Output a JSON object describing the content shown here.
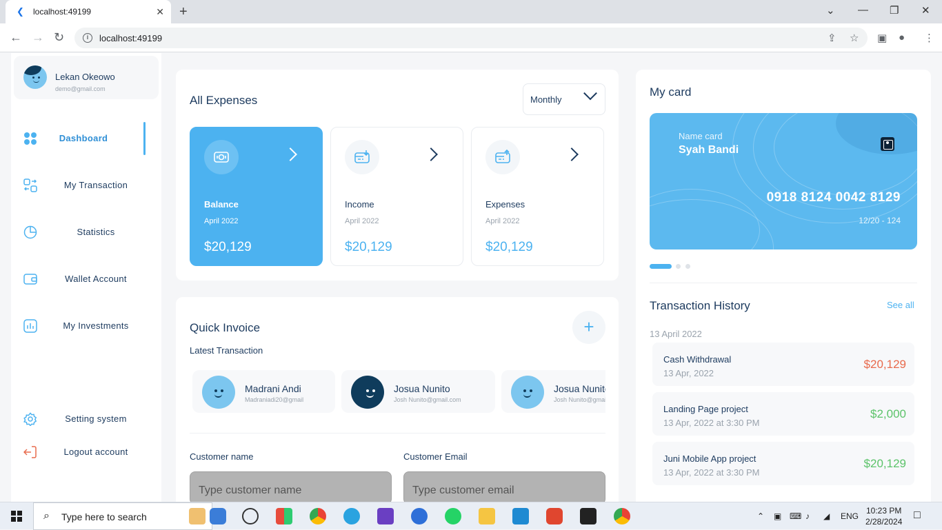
{
  "browser": {
    "tab_title": "localhost:49199",
    "url": "localhost:49199"
  },
  "profile": {
    "name": "Lekan Okeowo",
    "email": "demo@gmail.com"
  },
  "nav": {
    "dashboard": "Dashboard",
    "transaction": "My Transaction",
    "statistics": "Statistics",
    "wallet": "Wallet Account",
    "investments": "My Investments",
    "settings": "Setting system",
    "logout": "Logout account"
  },
  "expenses": {
    "title": "All Expenses",
    "period": "Monthly",
    "cards": [
      {
        "title": "Balance",
        "date": "April 2022",
        "value": "$20,129"
      },
      {
        "title": "Income",
        "date": "April 2022",
        "value": "$20,129"
      },
      {
        "title": "Expenses",
        "date": "April 2022",
        "value": "$20,129"
      }
    ]
  },
  "invoice": {
    "title": "Quick Invoice",
    "subtitle": "Latest Transaction",
    "contacts": [
      {
        "name": "Madrani Andi",
        "email": "Madraniadi20@gmail"
      },
      {
        "name": "Josua Nunito",
        "email": "Josh Nunito@gmail.com"
      },
      {
        "name": "Josua Nunito",
        "email": "Josh Nunito@gmail.com"
      }
    ],
    "customer_name_label": "Customer name",
    "customer_email_label": "Customer Email",
    "customer_name_placeholder": "Type customer name",
    "customer_email_placeholder": "Type customer email"
  },
  "mycard": {
    "title": "My card",
    "name_label": "Name card",
    "name": "Syah Bandi",
    "number": "0918 8124 0042 8129",
    "expiry": "12/20 - 124"
  },
  "history": {
    "title": "Transaction History",
    "see_all": "See all",
    "date": "13 April 2022",
    "items": [
      {
        "title": "Cash Withdrawal",
        "date": "13 Apr, 2022",
        "amount": "$20,129",
        "color": "#e86a4c"
      },
      {
        "title": "Landing Page project",
        "date": "13 Apr, 2022 at 3:30 PM",
        "amount": "$2,000",
        "color": "#5cc36a"
      },
      {
        "title": "Juni Mobile App project",
        "date": "13 Apr, 2022 at 3:30 PM",
        "amount": "$20,129",
        "color": "#5cc36a"
      }
    ]
  },
  "taskbar": {
    "search": "Type here to search",
    "lang": "ENG",
    "time": "10:23 PM",
    "date": "2/28/2024"
  },
  "colors": {
    "accent": "#4cb2f0",
    "text": "#1c3a5e"
  }
}
